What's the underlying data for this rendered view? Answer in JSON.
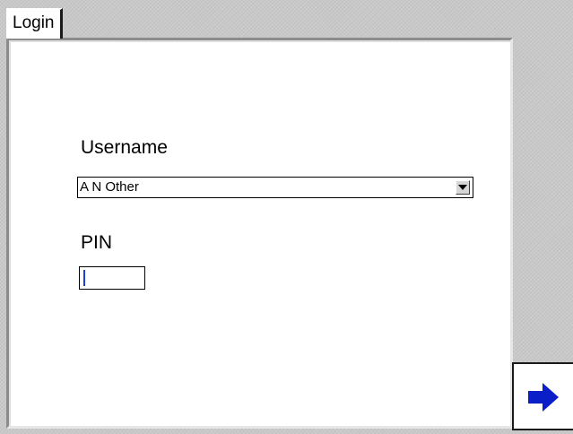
{
  "tab": {
    "label": "Login"
  },
  "form": {
    "username_label": "Username",
    "username_value": "A N Other",
    "pin_label": "PIN",
    "pin_value": ""
  },
  "icons": {
    "dropdown": "chevron-down-icon",
    "next": "arrow-right-icon"
  },
  "colors": {
    "background": "#c9c9c9",
    "panel": "#ffffff",
    "next_arrow": "#0a1fc8",
    "caret": "#1f3fd1"
  }
}
